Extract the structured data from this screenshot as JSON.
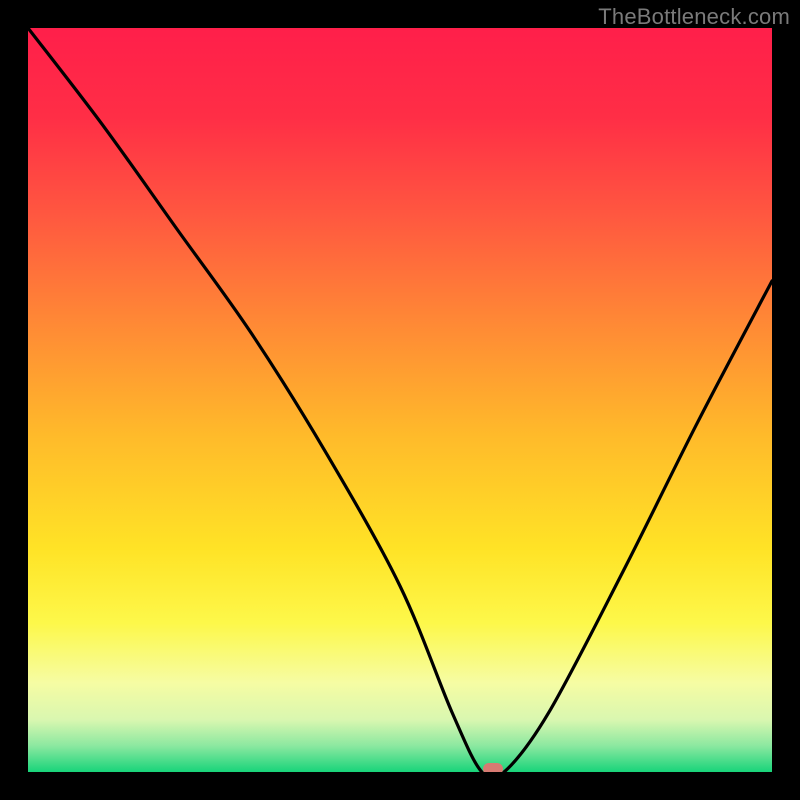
{
  "watermark": "TheBottleneck.com",
  "chart_data": {
    "type": "line",
    "title": "",
    "xlabel": "",
    "ylabel": "",
    "xlim": [
      0,
      100
    ],
    "ylim": [
      0,
      100
    ],
    "grid": false,
    "legend": false,
    "series": [
      {
        "name": "bottleneck-curve",
        "x": [
          0,
          10,
          20,
          30,
          40,
          50,
          57,
          61,
          64,
          70,
          80,
          90,
          100
        ],
        "values": [
          100,
          87,
          73,
          59,
          43,
          25,
          8,
          0,
          0,
          8,
          27,
          47,
          66
        ]
      }
    ],
    "marker": {
      "x": 62.5,
      "y": 0,
      "color": "#d77a72"
    },
    "gradient_stops": [
      {
        "offset": 0.0,
        "color": "#ff1f4a"
      },
      {
        "offset": 0.12,
        "color": "#ff2e46"
      },
      {
        "offset": 0.25,
        "color": "#ff5740"
      },
      {
        "offset": 0.4,
        "color": "#ff8a35"
      },
      {
        "offset": 0.55,
        "color": "#ffbb2a"
      },
      {
        "offset": 0.7,
        "color": "#ffe326"
      },
      {
        "offset": 0.8,
        "color": "#fdf84a"
      },
      {
        "offset": 0.88,
        "color": "#f6fca3"
      },
      {
        "offset": 0.93,
        "color": "#d9f7b0"
      },
      {
        "offset": 0.965,
        "color": "#8be8a0"
      },
      {
        "offset": 1.0,
        "color": "#18d47a"
      }
    ]
  }
}
